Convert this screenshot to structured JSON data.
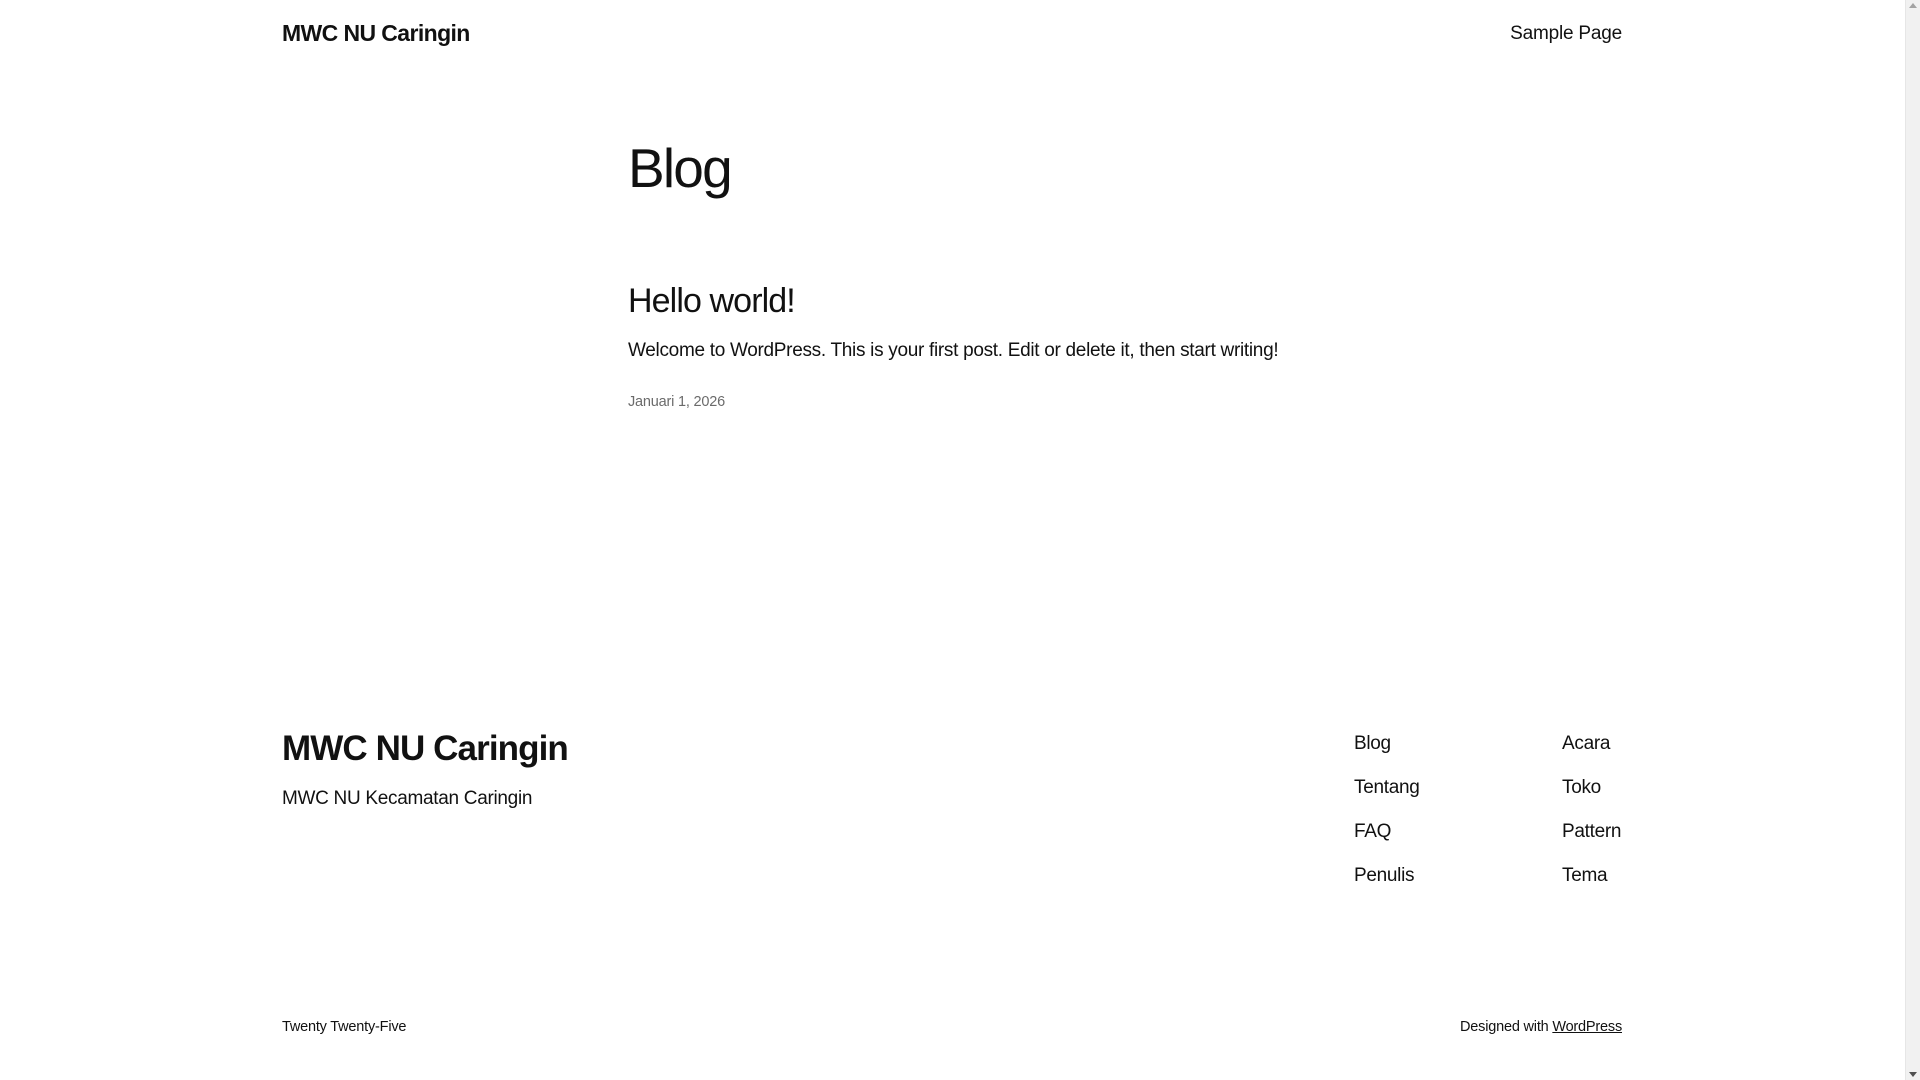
{
  "header": {
    "site_title": "MWC NU Caringin",
    "nav_items": [
      "Sample Page"
    ]
  },
  "main": {
    "heading": "Blog",
    "posts": [
      {
        "title": "Hello world!",
        "excerpt": "Welcome to WordPress. This is your first post. Edit or delete it, then start writing!",
        "date": "Januari 1, 2026"
      }
    ]
  },
  "footer": {
    "site_title": "MWC NU Caringin",
    "tagline": "MWC NU Kecamatan Caringin",
    "nav_col_1": [
      "Blog",
      "Tentang",
      "FAQ",
      "Penulis"
    ],
    "nav_col_2": [
      "Acara",
      "Toko",
      "Pattern",
      "Tema"
    ],
    "theme_credit": "Twenty Twenty-Five",
    "designed_with": "Designed with",
    "wordpress_link": "WordPress"
  },
  "colors": {
    "text": "#111111",
    "muted": "#6b6b6b",
    "background": "#ffffff"
  }
}
